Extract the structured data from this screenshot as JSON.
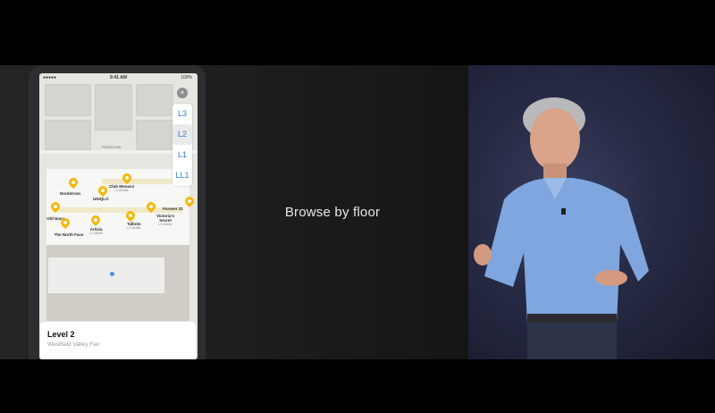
{
  "slide": {
    "caption": "Browse by floor"
  },
  "phone": {
    "status": {
      "time": "9:41 AM",
      "signal": "●●●●● ",
      "battery": "100%"
    },
    "floor_selector": {
      "floors": [
        "L3",
        "L2",
        "L1",
        "LL1"
      ],
      "active": "L2"
    },
    "close_icon": "×",
    "stores": [
      {
        "name": "Nordstrom",
        "sub": ""
      },
      {
        "name": "Club Monaco",
        "sub": "L2 Middle"
      },
      {
        "name": "UNIQLO",
        "sub": ""
      },
      {
        "name": "Forever 21",
        "sub": ""
      },
      {
        "name": "Old Navy",
        "sub": ""
      },
      {
        "name": "Victoria's Secret",
        "sub": "L2 Middle"
      },
      {
        "name": "Talbots",
        "sub": "L2 Middle"
      },
      {
        "name": "Aritzia",
        "sub": "L2 Middle"
      },
      {
        "name": "The North Face",
        "sub": ""
      }
    ],
    "road_label": "Forest Ave",
    "card": {
      "title": "Level 2",
      "subtitle": "Westfield Valley Fair"
    }
  },
  "colors": {
    "pin": "#f5b800",
    "floor_text": "#2f7de1",
    "location_dot": "#4a8ff0"
  }
}
